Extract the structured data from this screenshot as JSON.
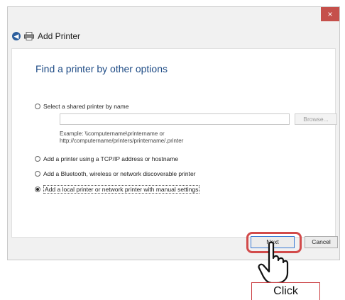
{
  "window": {
    "close_glyph": "×",
    "title": "Add Printer",
    "back_icon": "back-arrow-icon",
    "printer_icon": "printer-icon"
  },
  "main": {
    "heading": "Find a printer by other options",
    "options": [
      {
        "label": "Select a shared printer by name",
        "checked": false
      },
      {
        "label": "Add a printer using a TCP/IP address or hostname",
        "checked": false
      },
      {
        "label": "Add a Bluetooth, wireless or network discoverable printer",
        "checked": false
      },
      {
        "label": "Add a local printer or network printer with manual settings",
        "checked": true
      }
    ],
    "shared_printer_input": {
      "value": ""
    },
    "browse_label": "Browse...",
    "example_line1": "Example: \\\\computername\\printername or",
    "example_line2": "http://computername/printers/printername/.printer"
  },
  "footer": {
    "next_label": "Next",
    "cancel_label": "Cancel"
  },
  "annotation": {
    "click_label": "Click",
    "highlight_color": "#d24b4b"
  }
}
